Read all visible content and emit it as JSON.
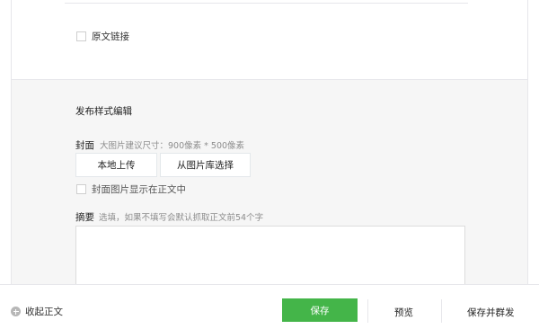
{
  "original_link": {
    "label": "原文链接",
    "checked": false
  },
  "publish_section": {
    "title": "发布样式编辑",
    "cover": {
      "label": "封面",
      "hint": "大图片建议尺寸：900像素 * 500像素",
      "upload_button": "本地上传",
      "library_button": "从图片库选择"
    },
    "show_cover_in_body": {
      "label": "封面图片显示在正文中",
      "checked": false
    },
    "summary": {
      "label": "摘要",
      "hint": "选填，如果不填写会默认抓取正文前54个字",
      "value": ""
    }
  },
  "footer": {
    "collapse_label": "收起正文",
    "save_label": "保存",
    "preview_label": "预览",
    "save_and_send_label": "保存并群发"
  },
  "colors": {
    "primary_green": "#44b549",
    "section_bg": "#f6f6f6",
    "border": "#e7e7eb",
    "hint_text": "#8d8d8d"
  }
}
